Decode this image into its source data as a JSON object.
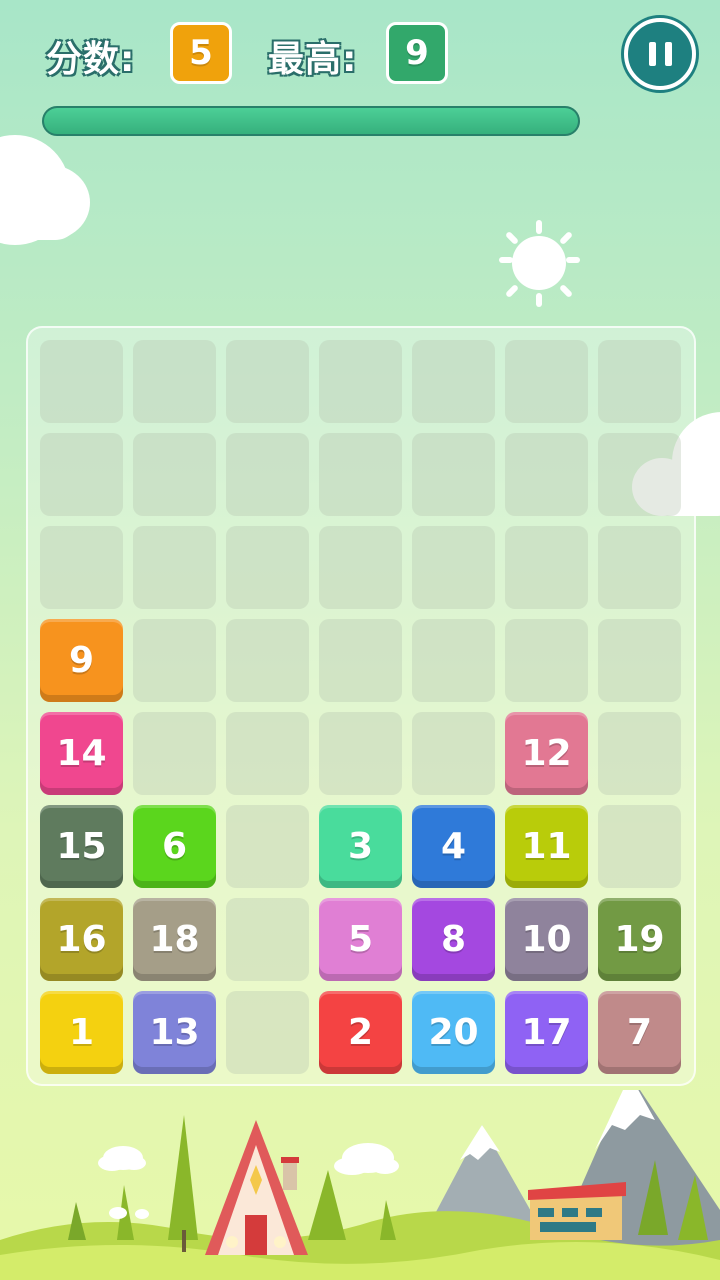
{
  "hud": {
    "score_label": "分数:",
    "score_value": "5",
    "best_label": "最高:",
    "best_value": "9",
    "score_color": "#f0a20c",
    "best_color": "#32a86b"
  },
  "progress": {
    "value": 1.0
  },
  "pause_icon": "pause-icon",
  "board": {
    "rows": 8,
    "cols": 7,
    "tiles": [
      {
        "row": 3,
        "col": 0,
        "label": "9",
        "color": "#f7931e"
      },
      {
        "row": 4,
        "col": 0,
        "label": "14",
        "color": "#f0478f"
      },
      {
        "row": 4,
        "col": 5,
        "label": "12",
        "color": "#e27893"
      },
      {
        "row": 5,
        "col": 0,
        "label": "15",
        "color": "#5f7b5e"
      },
      {
        "row": 5,
        "col": 1,
        "label": "6",
        "color": "#5bd61d"
      },
      {
        "row": 5,
        "col": 3,
        "label": "3",
        "color": "#49dc9c"
      },
      {
        "row": 5,
        "col": 4,
        "label": "4",
        "color": "#2f7ad9"
      },
      {
        "row": 5,
        "col": 5,
        "label": "11",
        "color": "#b9cc0a"
      },
      {
        "row": 6,
        "col": 0,
        "label": "16",
        "color": "#b3a52a"
      },
      {
        "row": 6,
        "col": 1,
        "label": "18",
        "color": "#a59e88"
      },
      {
        "row": 6,
        "col": 3,
        "label": "5",
        "color": "#e07fd4"
      },
      {
        "row": 6,
        "col": 4,
        "label": "8",
        "color": "#a448e0"
      },
      {
        "row": 6,
        "col": 5,
        "label": "10",
        "color": "#8f839c"
      },
      {
        "row": 6,
        "col": 6,
        "label": "19",
        "color": "#729a44"
      },
      {
        "row": 7,
        "col": 0,
        "label": "1",
        "color": "#f4d110"
      },
      {
        "row": 7,
        "col": 1,
        "label": "13",
        "color": "#7f83d9"
      },
      {
        "row": 7,
        "col": 3,
        "label": "2",
        "color": "#f44343"
      },
      {
        "row": 7,
        "col": 4,
        "label": "20",
        "color": "#4fbaf5"
      },
      {
        "row": 7,
        "col": 5,
        "label": "17",
        "color": "#8f62f4"
      },
      {
        "row": 7,
        "col": 6,
        "label": "7",
        "color": "#c08a8a"
      }
    ]
  }
}
